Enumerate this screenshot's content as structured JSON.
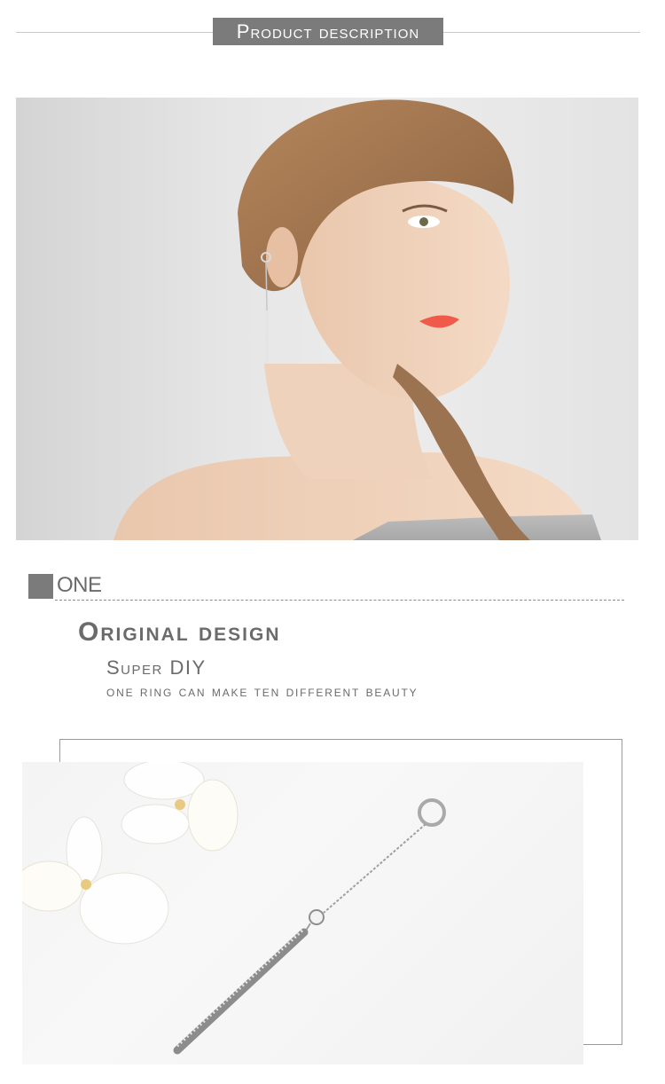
{
  "header": {
    "title": "Product description"
  },
  "section": {
    "label": "ONE",
    "heading": "Original design",
    "subheading": "Super DIY",
    "description": "one ring can make ten different beauty"
  },
  "colors": {
    "badge": "#7b7b7b",
    "text": "#6b6b6b",
    "rule": "#c9c9c9"
  }
}
